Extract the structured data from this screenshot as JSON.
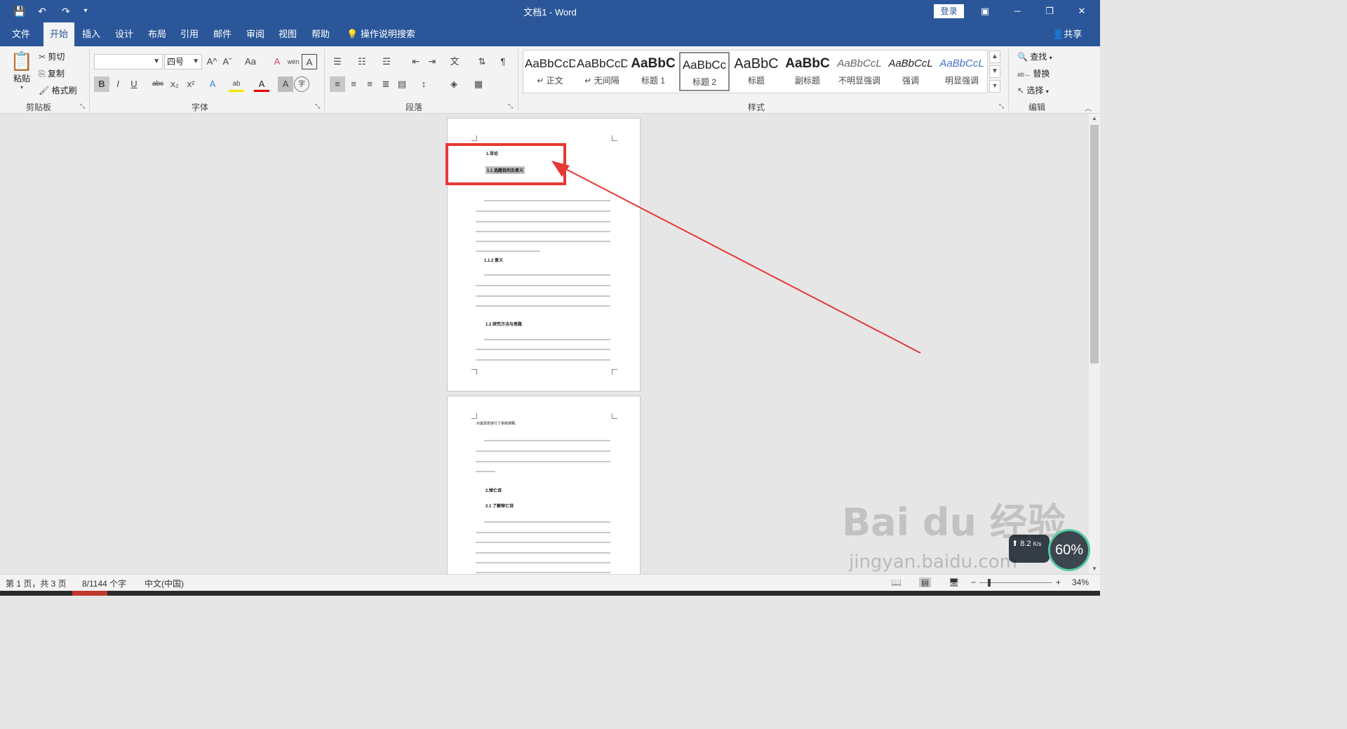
{
  "titlebar": {
    "title": "文档1  -  Word",
    "login": "登录",
    "qat": {
      "save": "💾",
      "undo": "↶",
      "redo": "↷",
      "customize": "▾"
    },
    "window": {
      "ribbon_display": "▣",
      "minimize": "─",
      "restore": "❐",
      "close": "✕"
    }
  },
  "tabs": [
    "文件",
    "开始",
    "插入",
    "设计",
    "布局",
    "引用",
    "邮件",
    "审阅",
    "视图",
    "帮助"
  ],
  "tellme": "操作说明搜索",
  "share": "共享",
  "clipboard": {
    "paste": "粘贴",
    "cut": "剪切",
    "copy": "复制",
    "format_painter": "格式刷",
    "label": "剪贴板"
  },
  "font": {
    "name": "",
    "size": "四号",
    "label": "字体",
    "grow": "A^",
    "shrink": "Aˇ",
    "case": "Aa",
    "clear": "A",
    "phonetic": "wén",
    "border": "A",
    "bold": "B",
    "italic": "I",
    "underline": "U",
    "strike": "abc",
    "subscript": "x₂",
    "superscript": "x²",
    "effects": "A",
    "highlight": "ab",
    "color": "A",
    "shade": "A",
    "circle": "字"
  },
  "paragraph": {
    "label": "段落"
  },
  "styles": {
    "label": "样式",
    "items": [
      {
        "sample": "AaBbCcD",
        "name": "↵ 正文"
      },
      {
        "sample": "AaBbCcD",
        "name": "↵ 无间隔"
      },
      {
        "sample": "AaBbC",
        "name": "标题 1"
      },
      {
        "sample": "AaBbCc",
        "name": "标题 2"
      },
      {
        "sample": "AaBbC",
        "name": "标题"
      },
      {
        "sample": "AaBbC",
        "name": "副标题"
      },
      {
        "sample": "AaBbCcL",
        "name": "不明显强调"
      },
      {
        "sample": "AaBbCcL",
        "name": "强调"
      },
      {
        "sample": "AaBbCcL",
        "name": "明显强调"
      }
    ]
  },
  "editing": {
    "find": "查找",
    "replace": "替换",
    "select": "选择",
    "label": "编辑"
  },
  "document": {
    "page1": {
      "h1": "1.导论",
      "h2": "1.1 选题目的及意义",
      "h3": "1.1.2 意义",
      "h4": "1.2 研究方法与思路"
    },
    "page2": {
      "p_first": "对其思想进行了系统阐释。",
      "h1": "2.悼亡诗",
      "h2": "2.1 了解悼亡诗"
    }
  },
  "statusbar": {
    "page": "第 1 页，共 3 页",
    "words": "8/1144 个字",
    "lang": "中文(中国)",
    "zoom_minus": "−",
    "zoom_plus": "+",
    "zoom": "34%",
    "zoom_level": 0.34
  },
  "overlay": {
    "watermark": "Bai du 经验",
    "watermark_url": "jingyan.baidu.com",
    "net_speed": "8.2",
    "net_unit": "K/s",
    "gauge": "60%"
  },
  "colors": {
    "word_blue": "#2b579a",
    "annotation_red": "#e53935"
  }
}
